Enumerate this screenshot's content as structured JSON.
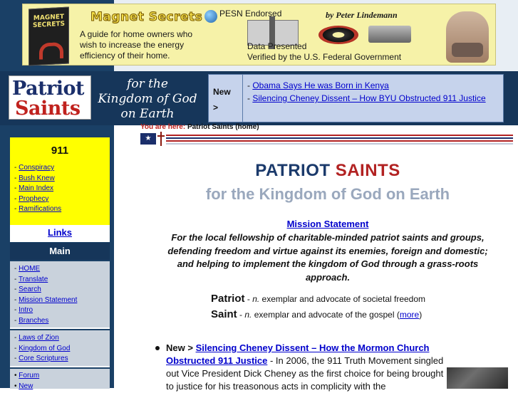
{
  "ad": {
    "book_title": "MAGNET SECRETS",
    "logo": "Magnet Secrets",
    "pitch": "A guide for home owners who wish to increase the energy efficiency of their home.",
    "endorsed": "PESN Endorsed",
    "data_line1": "Data Presented",
    "data_line2": "Verified by the U.S. Federal Government",
    "byline": "by Peter Lindemann"
  },
  "header": {
    "logo_line1": "Patriot",
    "logo_line2": "Saints",
    "tagline_line1": "for the",
    "tagline_line2": "Kingdom of God",
    "tagline_line3": "on Earth",
    "news_label": "New",
    "news_arrow": ">",
    "news": [
      {
        "prefix": "- ",
        "text": "Obama Says He was Born in Kenya"
      },
      {
        "prefix": "- ",
        "text": "Silencing Cheney Dissent – How BYU Obstructed 911 Justice"
      }
    ]
  },
  "breadcrumb": {
    "label": "You are here:",
    "current": "Patriot Saints (home)"
  },
  "sidebar": {
    "box911_title": "911",
    "box911_items": [
      "Conspiracy",
      "Bush Knew",
      "Main Index",
      "Prophecy",
      "Ramifications"
    ],
    "links_label": "Links",
    "main_label": "Main",
    "main_items": [
      "HOME",
      "Translate",
      "Search",
      "Mission Statement",
      "Intro",
      "Branches"
    ],
    "group2_items": [
      "Laws of Zion",
      "Kingdom of God",
      "Core Scriptures"
    ],
    "group3_items": [
      "Forum",
      "New"
    ]
  },
  "main": {
    "title_a": "PATRIOT",
    "title_b": "SAINTS",
    "subtitle": "for the Kingdom of God on Earth",
    "mission_link": "Mission Statement",
    "mission_text": "For the local fellowship of charitable-minded patriot saints and groups, defending freedom and virtue against its enemies, foreign and domestic; and helping to implement the kingdom of God through a grass-roots approach.",
    "def1_word": "Patriot",
    "def1_rest": "exemplar and advocate of societal freedom",
    "def2_word": "Saint",
    "def2_rest": "exemplar and advocate of the gospel",
    "more": "more",
    "story_new": "New >",
    "story_link": "Silencing Cheney Dissent – How the Mormon Church Obstructed 911 Justice",
    "story_text": "- In 2006, the 911 Truth Movement singled out Vice President Dick Cheney as the first choice for being brought to justice for his treasonous acts in complicity with the"
  },
  "colors": {
    "navy": "#16365a",
    "yellow": "#ffff00",
    "red": "#b22222",
    "link": "#0000cc"
  }
}
